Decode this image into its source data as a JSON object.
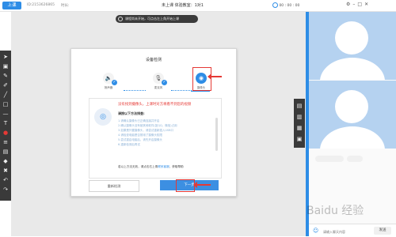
{
  "topbar": {
    "start_label": "上课",
    "room_id": "ID:2153626865",
    "time_label": "时长:",
    "status": "未上课   体验教室：1对1",
    "timer": "00 : 00 : 00",
    "window_icons": [
      "gear-icon",
      "minimize-icon",
      "maximize-icon",
      "close-icon"
    ]
  },
  "notice": "课程尚未开始，可点击左上角开始上课",
  "dialog": {
    "title": "设备检测",
    "steps": [
      {
        "label": "扬声器",
        "icon": "speaker-icon"
      },
      {
        "label": "麦克风",
        "icon": "mic-icon"
      },
      {
        "label": "摄像头",
        "icon": "camera-icon"
      }
    ],
    "error": "没有找到摄像头，上课时对方将看不到您的视频",
    "sub_title": "请按以下方法排查:",
    "tips": [
      "1.请确认摄像头已正确连接并开启",
      "2.确认摄像头没有被其他软件(如QQ、微信)占用",
      "3.如果是外置摄像头，请尝试重新插入USB口",
      "4.请检查电脑是否禁用了摄像头权限",
      "5.尝试重启电脑后，请先开启摄像头",
      "6.重新检测后再试"
    ],
    "footer": "若以上方法无效，请点击右上角",
    "footer_link": "联系客服",
    "footer_tail": "，获取帮助",
    "recheck_label": "重新检测",
    "next_label": "下一步"
  },
  "right_panel": {
    "input_placeholder": "请输入聊天内容",
    "send_label": "发送"
  },
  "watermark": "Baidu 经验",
  "colors": {
    "accent": "#2e8de6",
    "error": "#e53935",
    "toolbar": "#3a3a3a"
  }
}
